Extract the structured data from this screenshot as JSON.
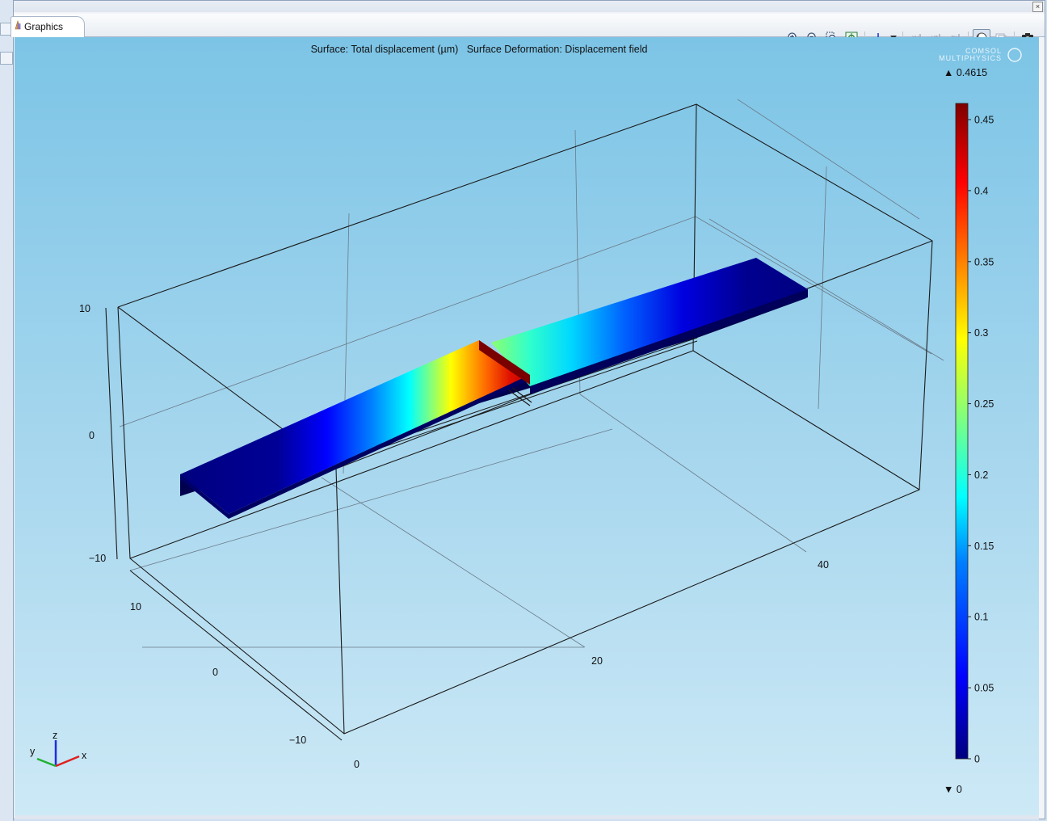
{
  "window": {
    "tab_label": "Graphics"
  },
  "toolbar": {
    "buttons": [
      "zoom-in-icon",
      "zoom-out-icon",
      "zoom-box-icon",
      "zoom-extents-icon",
      "axis-orientation-icon",
      "dropdown-icon",
      "view-xy-icon",
      "view-yz-icon",
      "view-zx-icon",
      "scene-light-icon",
      "transparency-icon",
      "camera-icon"
    ],
    "view_labels": {
      "xy": "xy",
      "yz": "yz",
      "zx": "zx"
    }
  },
  "plot": {
    "title": "Surface: Total displacement (µm)   Surface Deformation: Displacement field",
    "logo_line1": "COMSOL",
    "logo_line2": "MULTIPHYSICS",
    "z_ticks": [
      "10",
      "0",
      "−10"
    ],
    "y_ticks": [
      "10",
      "0",
      "−10"
    ],
    "x_ticks": [
      "0",
      "20",
      "40"
    ],
    "triad": {
      "x": "x",
      "y": "y",
      "z": "z"
    }
  },
  "colorbar": {
    "max_label": "▲ 0.4615",
    "min_label": "▼ 0",
    "ticks": [
      "0.45",
      "0.4",
      "0.35",
      "0.3",
      "0.25",
      "0.2",
      "0.15",
      "0.1",
      "0.05",
      "0"
    ],
    "colormap": [
      "#00007f",
      "#0000ff",
      "#007fff",
      "#00ffff",
      "#7fff7f",
      "#ffff00",
      "#ff7f00",
      "#ff0000",
      "#7f0000"
    ]
  }
}
